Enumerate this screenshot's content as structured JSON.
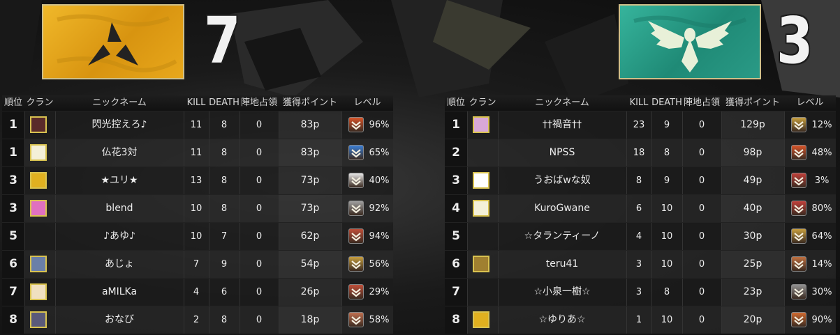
{
  "headers": {
    "rank": "順位",
    "clan": "クラン",
    "nick": "ニックネーム",
    "kill": "KILL",
    "death": "DEATH",
    "capture": "陣地占領",
    "points": "獲得ポイント",
    "level": "レベル"
  },
  "team_left": {
    "score": "7",
    "flag_color": "#e8a81c",
    "players": [
      {
        "rank": "1",
        "nick": "閃光控えろ♪",
        "kill": "11",
        "death": "8",
        "capture": "0",
        "points": "83p",
        "level": "96%",
        "clan_icon": "round-emblem-icon",
        "clan_color": "#5a2a2a",
        "level_color": "#d9552a"
      },
      {
        "rank": "1",
        "nick": "仏花3対",
        "kill": "11",
        "death": "8",
        "capture": "0",
        "points": "83p",
        "level": "65%",
        "clan_icon": "silhouette-icon",
        "clan_color": "#f4f0d8",
        "level_color": "#3b7fd6"
      },
      {
        "rank": "3",
        "nick": "★ユリ★",
        "kill": "13",
        "death": "8",
        "capture": "0",
        "points": "73p",
        "level": "40%",
        "clan_icon": "bh-logo-icon",
        "clan_color": "#e0b020",
        "level_color": "#e8e8e8"
      },
      {
        "rank": "3",
        "nick": "blend",
        "kill": "10",
        "death": "8",
        "capture": "0",
        "points": "73p",
        "level": "92%",
        "clan_icon": "pink-star-icon",
        "clan_color": "#e070c0",
        "level_color": "#a0a0a0"
      },
      {
        "rank": "5",
        "nick": "♪あゆ♪",
        "kill": "10",
        "death": "7",
        "capture": "0",
        "points": "62p",
        "level": "94%",
        "clan_icon": "",
        "clan_color": "",
        "level_color": "#c0503a"
      },
      {
        "rank": "6",
        "nick": "あじょ",
        "kill": "7",
        "death": "9",
        "capture": "0",
        "points": "54p",
        "level": "56%",
        "clan_icon": "blue-crest-icon",
        "clan_color": "#6a7fa8",
        "level_color": "#c8a040"
      },
      {
        "rank": "7",
        "nick": "aMILKa",
        "kill": "4",
        "death": "6",
        "capture": "0",
        "points": "26p",
        "level": "29%",
        "clan_icon": "kanji-sword-icon",
        "clan_color": "#f0e0c0",
        "level_color": "#c0503a"
      },
      {
        "rank": "8",
        "nick": "おなび",
        "kill": "2",
        "death": "8",
        "capture": "0",
        "points": "18p",
        "level": "58%",
        "clan_icon": "dark-figure-icon",
        "clan_color": "#5a5a7a",
        "level_color": "#c07050"
      }
    ]
  },
  "team_right": {
    "score": "3",
    "flag_color": "#2a9a86",
    "players": [
      {
        "rank": "1",
        "nick": "††禍音††",
        "kill": "23",
        "death": "9",
        "capture": "0",
        "points": "129p",
        "level": "12%",
        "clan_icon": "anime-girl-icon",
        "clan_color": "#d8a8d8",
        "level_color": "#c8a040"
      },
      {
        "rank": "2",
        "nick": "NPSS",
        "kill": "18",
        "death": "8",
        "capture": "0",
        "points": "98p",
        "level": "48%",
        "clan_icon": "",
        "clan_color": "",
        "level_color": "#d9552a"
      },
      {
        "rank": "3",
        "nick": "うおばwな奴",
        "kill": "8",
        "death": "9",
        "capture": "0",
        "points": "49p",
        "level": "3%",
        "clan_icon": "blank-white-icon",
        "clan_color": "#ffffff",
        "level_color": "#c0403a"
      },
      {
        "rank": "4",
        "nick": "KuroGwane",
        "kill": "6",
        "death": "10",
        "capture": "0",
        "points": "40p",
        "level": "80%",
        "clan_icon": "silhouette-icon",
        "clan_color": "#f4f0d8",
        "level_color": "#c0403a"
      },
      {
        "rank": "5",
        "nick": "☆タランティーノ",
        "kill": "4",
        "death": "10",
        "capture": "0",
        "points": "30p",
        "level": "64%",
        "clan_icon": "",
        "clan_color": "",
        "level_color": "#c8a040"
      },
      {
        "rank": "6",
        "nick": "teru41",
        "kill": "3",
        "death": "10",
        "capture": "0",
        "points": "25p",
        "level": "14%",
        "clan_icon": "gold-coin-icon",
        "clan_color": "#a08030",
        "level_color": "#c07040"
      },
      {
        "rank": "7",
        "nick": "☆小泉一樹☆",
        "kill": "3",
        "death": "8",
        "capture": "0",
        "points": "23p",
        "level": "30%",
        "clan_icon": "",
        "clan_color": "",
        "level_color": "#909090"
      },
      {
        "rank": "8",
        "nick": "☆ゆりあ☆",
        "kill": "1",
        "death": "10",
        "capture": "0",
        "points": "20p",
        "level": "90%",
        "clan_icon": "bh-logo-icon",
        "clan_color": "#e0b020",
        "level_color": "#d06a30"
      }
    ]
  }
}
